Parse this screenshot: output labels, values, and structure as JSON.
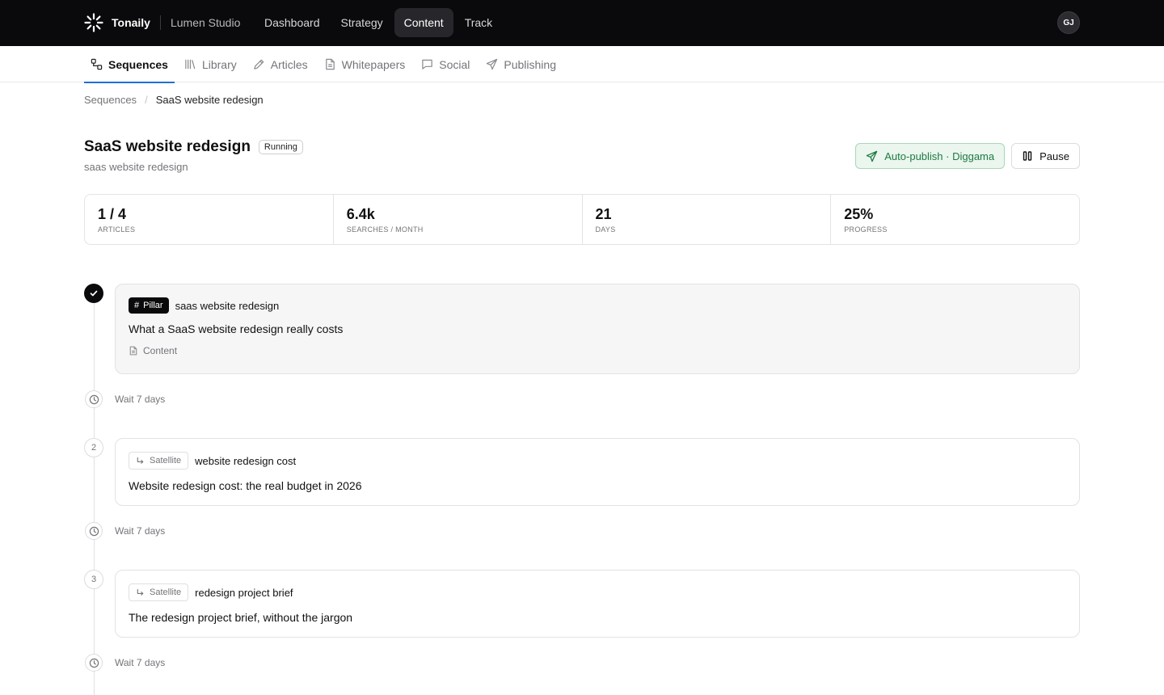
{
  "app": {
    "brand": "Tonaily",
    "workspace": "Lumen Studio",
    "avatar_initials": "GJ"
  },
  "main_nav": [
    {
      "label": "Dashboard",
      "active": false
    },
    {
      "label": "Strategy",
      "active": false
    },
    {
      "label": "Content",
      "active": true
    },
    {
      "label": "Track",
      "active": false
    }
  ],
  "sub_nav": [
    {
      "label": "Sequences",
      "icon": "sequences-icon",
      "active": true
    },
    {
      "label": "Library",
      "icon": "library-icon",
      "active": false
    },
    {
      "label": "Articles",
      "icon": "pencil-icon",
      "active": false
    },
    {
      "label": "Whitepapers",
      "icon": "document-icon",
      "active": false
    },
    {
      "label": "Social",
      "icon": "chat-icon",
      "active": false
    },
    {
      "label": "Publishing",
      "icon": "send-icon",
      "active": false
    }
  ],
  "breadcrumb": {
    "parent": "Sequences",
    "separator": "/",
    "current": "SaaS website redesign"
  },
  "header": {
    "title": "SaaS website redesign",
    "status": "Running",
    "subtitle": "saas website redesign",
    "autopublish_label": "Auto-publish · Diggama",
    "pause_label": "Pause"
  },
  "stats": [
    {
      "value": "1 / 4",
      "label": "ARTICLES"
    },
    {
      "value": "6.4k",
      "label": "SEARCHES / MONTH"
    },
    {
      "value": "21",
      "label": "DAYS"
    },
    {
      "value": "25%",
      "label": "PROGRESS"
    }
  ],
  "steps": [
    {
      "number": "",
      "done": true,
      "type": "Pillar",
      "keyword": "saas website redesign",
      "title": "What a SaaS website redesign really costs",
      "meta": "Content"
    },
    {
      "number": "2",
      "done": false,
      "type": "Satellite",
      "keyword": "website redesign cost",
      "title": "Website redesign cost: the real budget in 2026"
    },
    {
      "number": "3",
      "done": false,
      "type": "Satellite",
      "keyword": "redesign project brief",
      "title": "The redesign project brief, without the jargon"
    }
  ],
  "waits": [
    "Wait 7 days",
    "Wait 7 days",
    "Wait 7 days"
  ],
  "colors": {
    "topbar": "#0a0a0c",
    "accent": "#1f6fd6",
    "autopublish_green": "#1d7a43"
  }
}
